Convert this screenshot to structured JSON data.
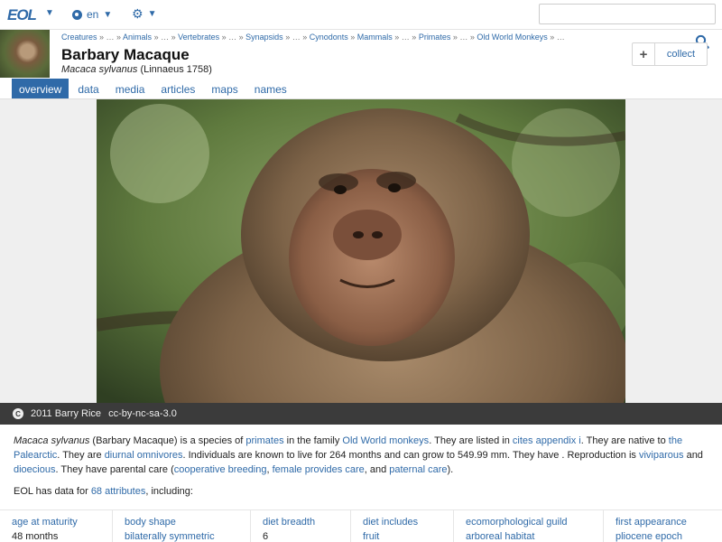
{
  "topbar": {
    "logo": "EOL",
    "language": "en",
    "search_placeholder": ""
  },
  "header": {
    "breadcrumb": [
      "Creatures",
      "…",
      "Animals",
      "…",
      "Vertebrates",
      "…",
      "Synapsids",
      "…",
      "Cynodonts",
      "Mammals",
      "…",
      "Primates",
      "…",
      "Old World Monkeys",
      "…"
    ],
    "title": "Barbary Macaque",
    "scientific_name": "Macaca sylvanus",
    "authority": "(Linnaeus 1758)",
    "collect_label": "collect"
  },
  "tabs": [
    {
      "label": "overview",
      "active": true
    },
    {
      "label": "data",
      "active": false
    },
    {
      "label": "media",
      "active": false
    },
    {
      "label": "articles",
      "active": false
    },
    {
      "label": "maps",
      "active": false
    },
    {
      "label": "names",
      "active": false
    }
  ],
  "image": {
    "cc_symbol": "C",
    "credit": "2011 Barry Rice",
    "license": "cc-by-nc-sa-3.0"
  },
  "description": {
    "sci": "Macaca sylvanus",
    "t1": " (Barbary Macaque) is a species of ",
    "l1": "primates",
    "t2": " in the family ",
    "l2": "Old World monkeys",
    "t3": ". They are listed in ",
    "l3": "cites appendix i",
    "t4": ". They are native to ",
    "l4": "the Palearctic",
    "t5": ". They are ",
    "l5": "diurnal omnivores",
    "t6": ". Individuals are known to live for 264 months and can grow to 549.99 mm. They have . Reproduction is ",
    "l6": "viviparous",
    "t7": " and ",
    "l7": "dioecious",
    "t8": ". They have parental care (",
    "l8": "cooperative breeding",
    "t9": ", ",
    "l9": "female provides care",
    "t10": ", and ",
    "l10": "paternal care",
    "t11": ")."
  },
  "attributes_summary": {
    "prefix": "EOL has data for ",
    "link": "68 attributes",
    "suffix": ", including:"
  },
  "attributes": [
    {
      "key": "age at maturity",
      "value": "48 months",
      "value_link": false
    },
    {
      "key": "body shape",
      "value": "bilaterally symmetric",
      "value_link": true
    },
    {
      "key": "diet breadth",
      "value": "6",
      "value_link": false
    },
    {
      "key": "diet includes",
      "value": "fruit",
      "value_link": true
    },
    {
      "key": "ecomorphological guild",
      "value": "arboreal habitat",
      "value_link": true
    },
    {
      "key": "first appearance",
      "value": "pliocene epoch",
      "value_link": true
    }
  ],
  "colors": {
    "link": "#2f6aa8",
    "active_tab_bg": "#2f6aa8",
    "caption_bg": "#3b3b3b"
  }
}
